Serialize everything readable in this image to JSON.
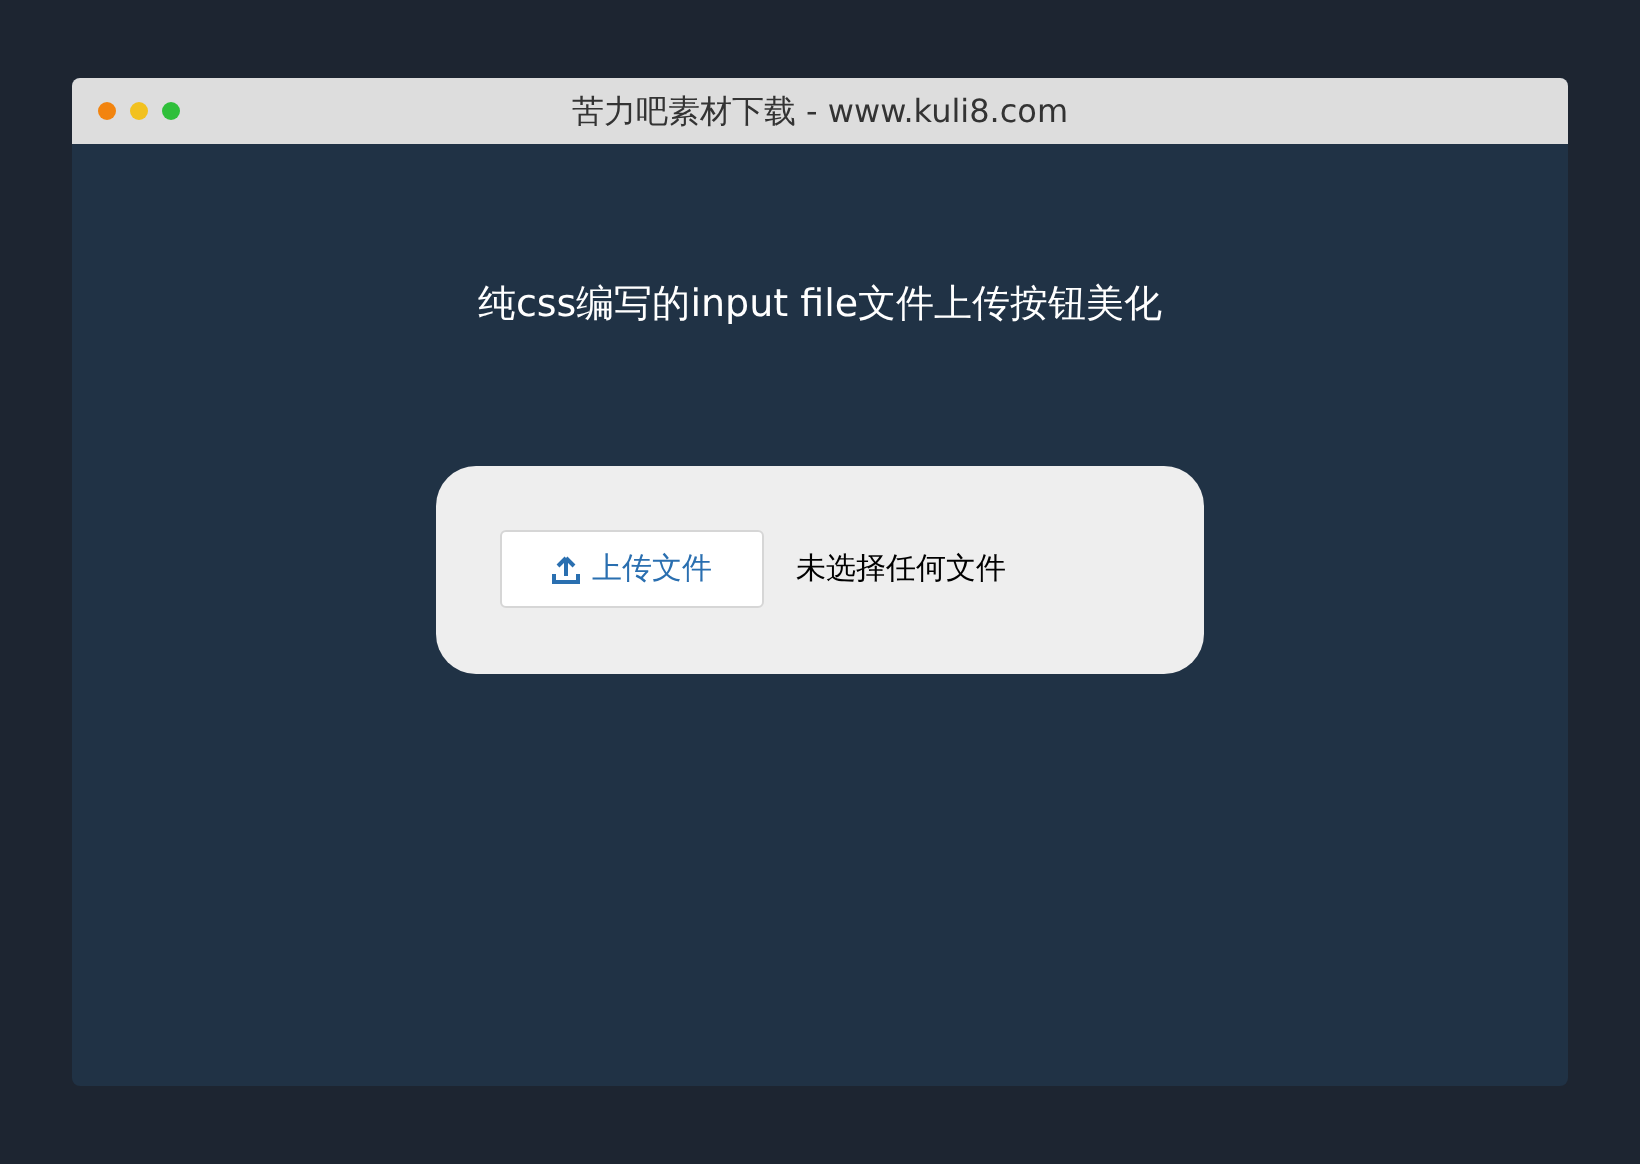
{
  "window": {
    "title": "苦力吧素材下载 - www.kuli8.com",
    "controls": [
      {
        "color": "#f2840f"
      },
      {
        "color": "#f2c11f"
      },
      {
        "color": "#2fbf3a"
      }
    ]
  },
  "heading": "纯css编写的input file文件上传按钮美化",
  "upload": {
    "button": "上传文件",
    "status": "未选择任何文件"
  }
}
